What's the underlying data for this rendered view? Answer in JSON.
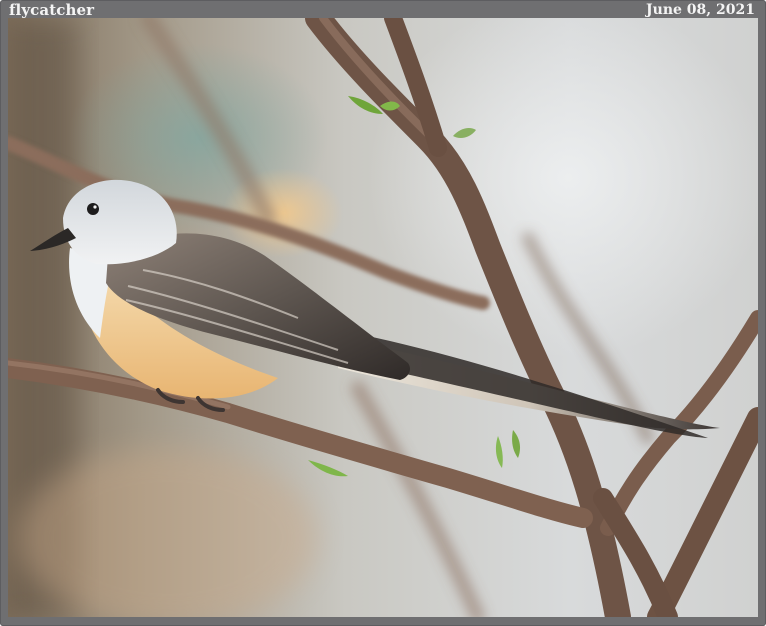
{
  "header": {
    "title": "flycatcher",
    "date": "June 08, 2021"
  },
  "photo": {
    "subject": "scissor-tailed flycatcher perched on a branch",
    "palette": {
      "frame": "#6f6f71",
      "background_light": "#d9dbdc",
      "background_warm": "#b7a68e",
      "branch": "#7a5d4d",
      "bird_head": "#e8ebee",
      "bird_belly": "#f1c98c",
      "bird_wing": "#5a5551"
    }
  }
}
